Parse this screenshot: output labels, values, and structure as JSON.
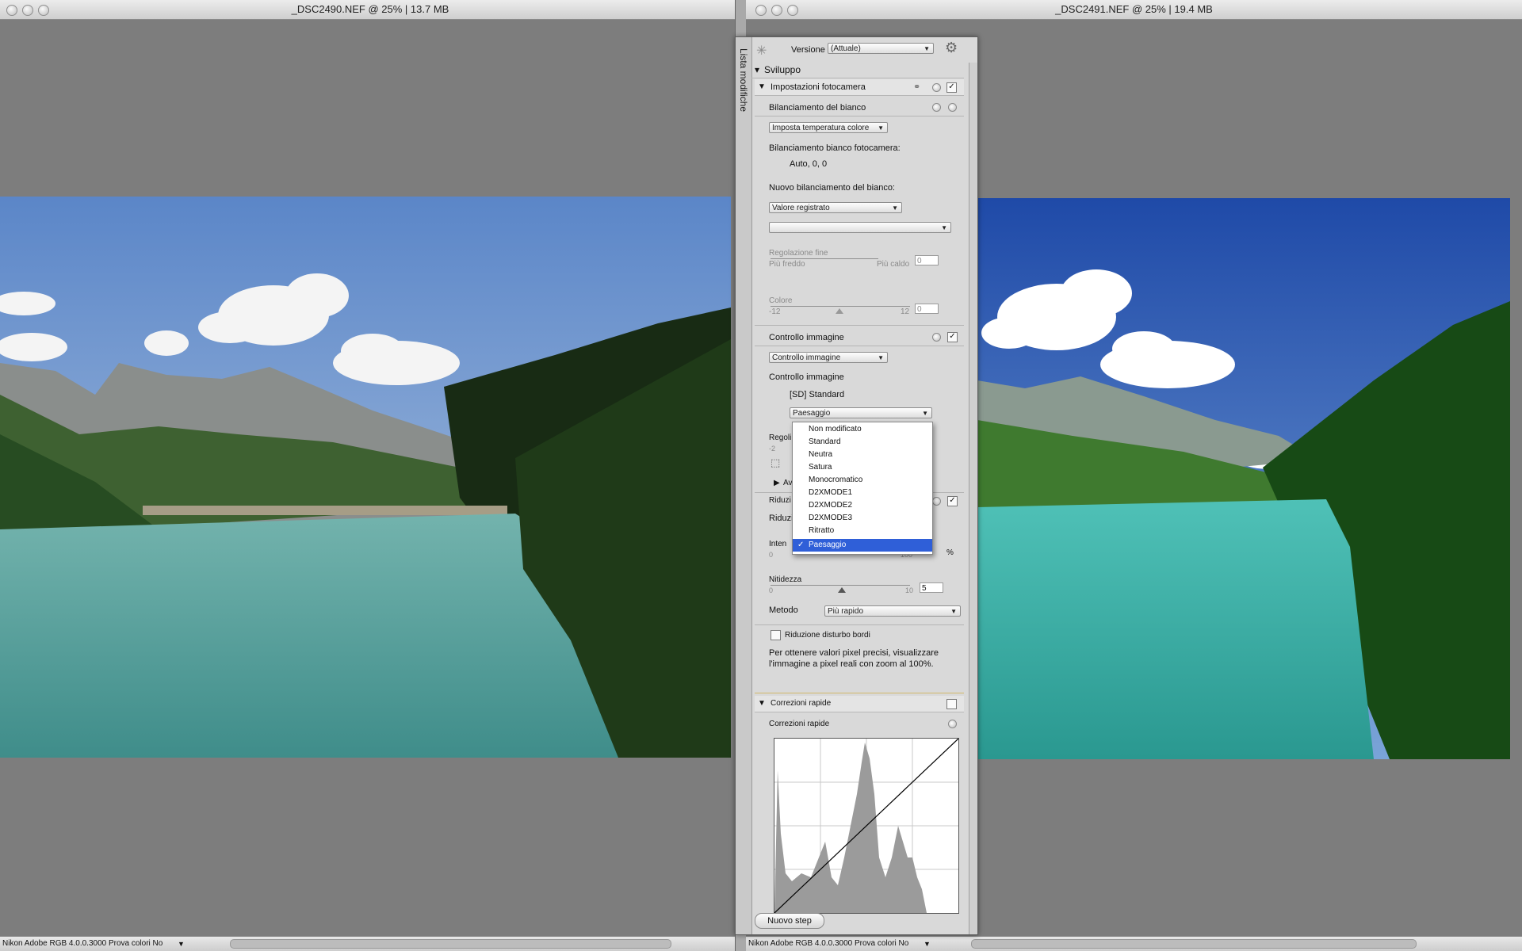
{
  "windows": {
    "left": {
      "title": "_DSC2490.NEF @ 25% | 13.7 MB",
      "status": "Nikon Adobe RGB 4.0.0.3000  Prova colori No"
    },
    "right": {
      "title": "_DSC2491.NEF @ 25% | 19.4 MB",
      "status": "Nikon Adobe RGB 4.0.0.3000  Prova colori No"
    }
  },
  "panel": {
    "side_tab": "Lista modifiche",
    "versione_label": "Versione",
    "versione_value": "(Attuale)",
    "sviluppo": "Sviluppo",
    "camera": {
      "title": "Impostazioni fotocamera",
      "wb_title": "Bilanciamento del bianco",
      "wb_select": "Imposta temperatura colore",
      "wb_camera_label": "Bilanciamento bianco fotocamera:",
      "wb_camera_value": "Auto, 0, 0",
      "wb_new_label": "Nuovo bilanciamento del bianco:",
      "wb_new_select": "Valore registrato",
      "fine_title": "Regolazione fine",
      "fine_cold": "Più freddo",
      "fine_warm": "Più caldo",
      "fine_value": "0",
      "colore_title": "Colore",
      "colore_min": "-12",
      "colore_max": "12",
      "colore_value": "0"
    },
    "image_control": {
      "title": "Controllo immagine",
      "select": "Controllo immagine",
      "label": "Controllo immagine",
      "current": "[SD] Standard",
      "picture_select": "Paesaggio",
      "hidden_regol": "Regoli",
      "hidden_minus": "-2",
      "hidden_av": "Av"
    },
    "noise": {
      "title": "Riduzi",
      "sub": "Riduzi",
      "intensity": "Inten",
      "intensity_zero": "0",
      "intensity_hundred": "100",
      "percent": "%",
      "sharpness_title": "Nitidezza",
      "sharpness_min": "0",
      "sharpness_max": "10",
      "sharpness_value": "5",
      "method_label": "Metodo",
      "method_value": "Più rapido",
      "edge_label": "Riduzione disturbo bordi",
      "note_line1": "Per ottenere valori pixel precisi, visualizzare",
      "note_line2": "l'immagine a pixel reali con zoom al 100%."
    },
    "quick": {
      "title": "Correzioni rapide",
      "sub": "Correzioni rapide"
    },
    "new_step": "Nuovo step"
  },
  "menu": {
    "items": [
      "Non modificato",
      "Standard",
      "Neutra",
      "Satura",
      "Monocromatico",
      "D2XMODE1",
      "D2XMODE2",
      "D2XMODE3",
      "Ritratto",
      "Paesaggio"
    ],
    "selected": "Paesaggio",
    "check_glyph": "✓"
  },
  "colors": {
    "selection": "#2f5fd8",
    "panel": "#d9d9d9",
    "canvas_bg": "#7d7d7d"
  }
}
